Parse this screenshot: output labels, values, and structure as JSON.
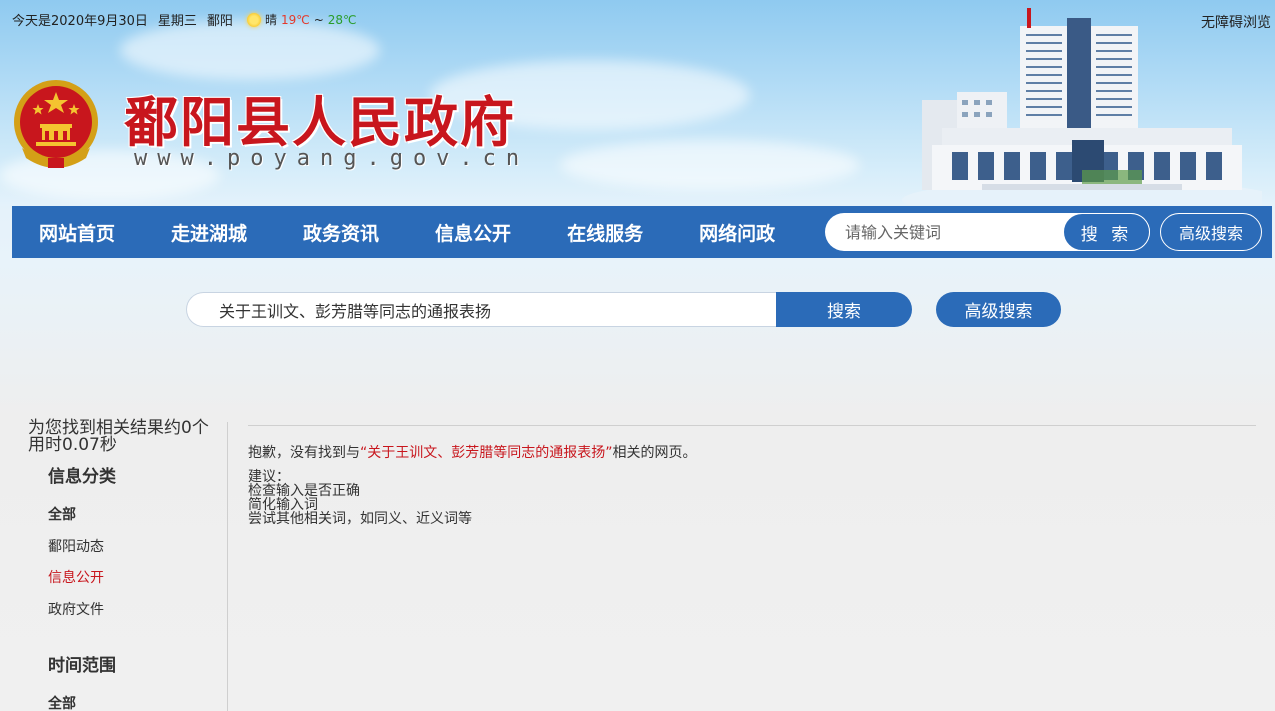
{
  "topbar": {
    "date": "今天是2020年9月30日",
    "weekday": "星期三",
    "city": "鄱阳",
    "weather": "晴",
    "temp_low": "19℃",
    "temp_sep": "~",
    "temp_high": "28℃",
    "accessibility": "无障碍浏览"
  },
  "header": {
    "site_title": "鄱阳县人民政府",
    "site_url": "www.poyang.gov.cn"
  },
  "nav": {
    "items": [
      {
        "label": "网站首页"
      },
      {
        "label": "走进湖城"
      },
      {
        "label": "政务资讯"
      },
      {
        "label": "信息公开"
      },
      {
        "label": "在线服务"
      },
      {
        "label": "网络问政"
      }
    ],
    "search_placeholder": "请输入关键词",
    "search_button": "搜 索",
    "advanced_button": "高级搜索"
  },
  "search": {
    "query": "关于王训文、彭芳腊等同志的通报表扬",
    "button": "搜索",
    "advanced_button": "高级搜索"
  },
  "sidebar": {
    "result_line1": "为您找到相关结果约0个",
    "result_line2": "用时0.07秒",
    "category_heading": "信息分类",
    "categories": [
      {
        "label": "全部"
      },
      {
        "label": "鄱阳动态"
      },
      {
        "label": "信息公开"
      },
      {
        "label": "政府文件"
      }
    ],
    "time_heading": "时间范围",
    "time_options": [
      {
        "label": "全部"
      }
    ]
  },
  "results": {
    "msg_prefix": "抱歉，没有找到与",
    "msg_keyword": "“关于王训文、彭芳腊等同志的通报表扬”",
    "msg_suffix": "相关的网页。",
    "suggest_title": "建议：",
    "suggestions": [
      "检查输入是否正确",
      "简化输入词",
      "尝试其他相关词，如同义、近义词等"
    ]
  },
  "colors": {
    "nav_blue": "#2b6bb8",
    "accent_red": "#c8161d"
  }
}
